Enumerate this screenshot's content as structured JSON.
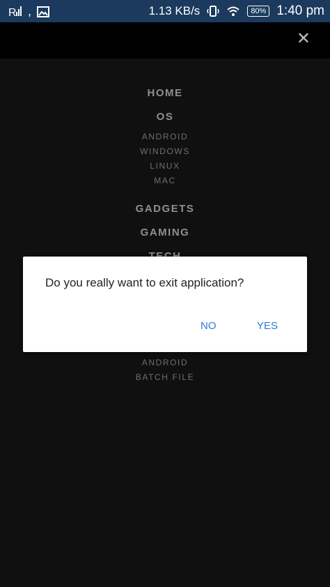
{
  "status_bar": {
    "signal": "R",
    "comma": ",",
    "net_speed": "1.13 KB/s",
    "battery": "80%",
    "time": "1:40 pm"
  },
  "header": {
    "close_icon": "close-icon"
  },
  "menu": {
    "home": "HOME",
    "os": "OS",
    "os_items": [
      "ANDROID",
      "WINDOWS",
      "LINUX",
      "MAC"
    ],
    "gadgets": "GADGETS",
    "gaming": "GAMING",
    "tech": "TECH",
    "lower_items": [
      "ANDROID",
      "BATCH FILE"
    ]
  },
  "dialog": {
    "message": "Do you really want to exit application?",
    "no_label": "NO",
    "yes_label": "YES",
    "accent": "#2d7bd8"
  }
}
